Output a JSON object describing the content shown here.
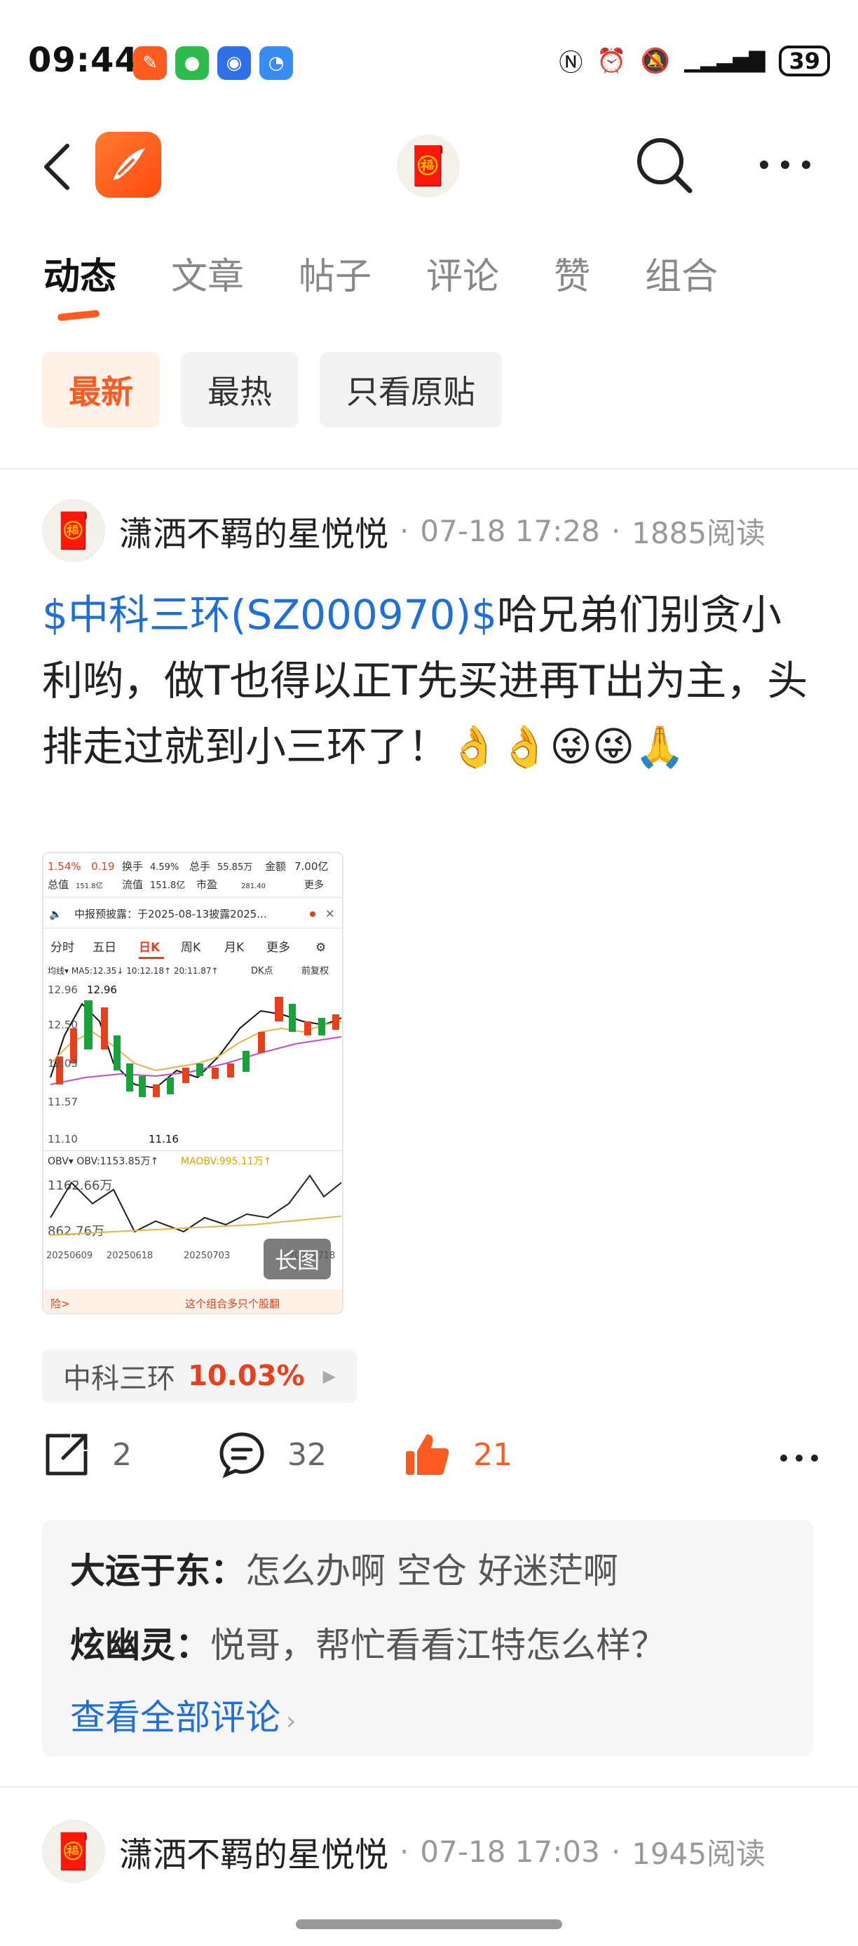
{
  "status_bar": {
    "time": "09:44",
    "battery": "39"
  },
  "tabs": [
    {
      "label": "动态",
      "active": true
    },
    {
      "label": "文章"
    },
    {
      "label": "帖子"
    },
    {
      "label": "评论"
    },
    {
      "label": "赞"
    },
    {
      "label": "组合"
    }
  ],
  "filters": [
    {
      "label": "最新",
      "active": true
    },
    {
      "label": "最热"
    },
    {
      "label": "只看原贴"
    }
  ],
  "post1": {
    "author": "潇洒不羁的星悦悦",
    "datetime": "07-18 17:28",
    "reads": "1885阅读",
    "stock_link": "$中科三环(SZ000970)$",
    "body": "哈兄弟们别贪小利哟，做T也得以正T先买进再T出为主，头排走过就到小三环了！👌👌😜😜🙏",
    "image_badge": "长图",
    "stock_chip_name": "中科三环",
    "stock_chip_pct": "10.03%",
    "shares": "2",
    "comments_count": "32",
    "likes": "21",
    "comments": [
      {
        "user": "大运于东：",
        "text": "怎么办啊 空仓 好迷茫啊"
      },
      {
        "user": "炫幽灵：",
        "text": "悦哥，帮忙看看江特怎么样？"
      }
    ],
    "view_all": "查看全部评论"
  },
  "post2": {
    "author": "潇洒不羁的星悦悦",
    "datetime": "07-18 17:03",
    "reads": "1945阅读"
  },
  "thumb": {
    "pct": "1.54%",
    "chg": "0.19",
    "turnover_label": "换手",
    "turnover": "4.59%",
    "vol_label": "总手",
    "vol": "55.85万",
    "amount_label": "金额",
    "amount": "7.00亿",
    "mktcap_label": "总值",
    "mktcap": "151.8亿",
    "float_label": "流值",
    "float": "151.8亿",
    "pe_label": "市盈",
    "pe": "281.40",
    "more": "更多",
    "notice": "中报预披露：于2025-08-13披露2025...",
    "periods": [
      "分时",
      "五日",
      "日K",
      "周K",
      "月K",
      "更多"
    ],
    "ma_line": "均线▾  MA5:12.35↓ 10:12.18↑ 20:11.87↑",
    "dk": "DK点",
    "fq": "前复权",
    "price_hi": "12.96",
    "price_marker": "12.96",
    "y_ticks": [
      "12.50",
      "12.03",
      "11.57",
      "11.10"
    ],
    "low_marker": "11.16",
    "obv_line": "OBV▾ OBV:1153.85万↑",
    "maobv": "MAOBV:995.11万↑",
    "obv_hi": "1162.66万",
    "obv_lo": "862.76万",
    "dates": [
      "20250609",
      "20250618",
      "20250703",
      "20250718"
    ],
    "footer_left": "险>",
    "footer_right": "这个组合多只个股翻"
  }
}
